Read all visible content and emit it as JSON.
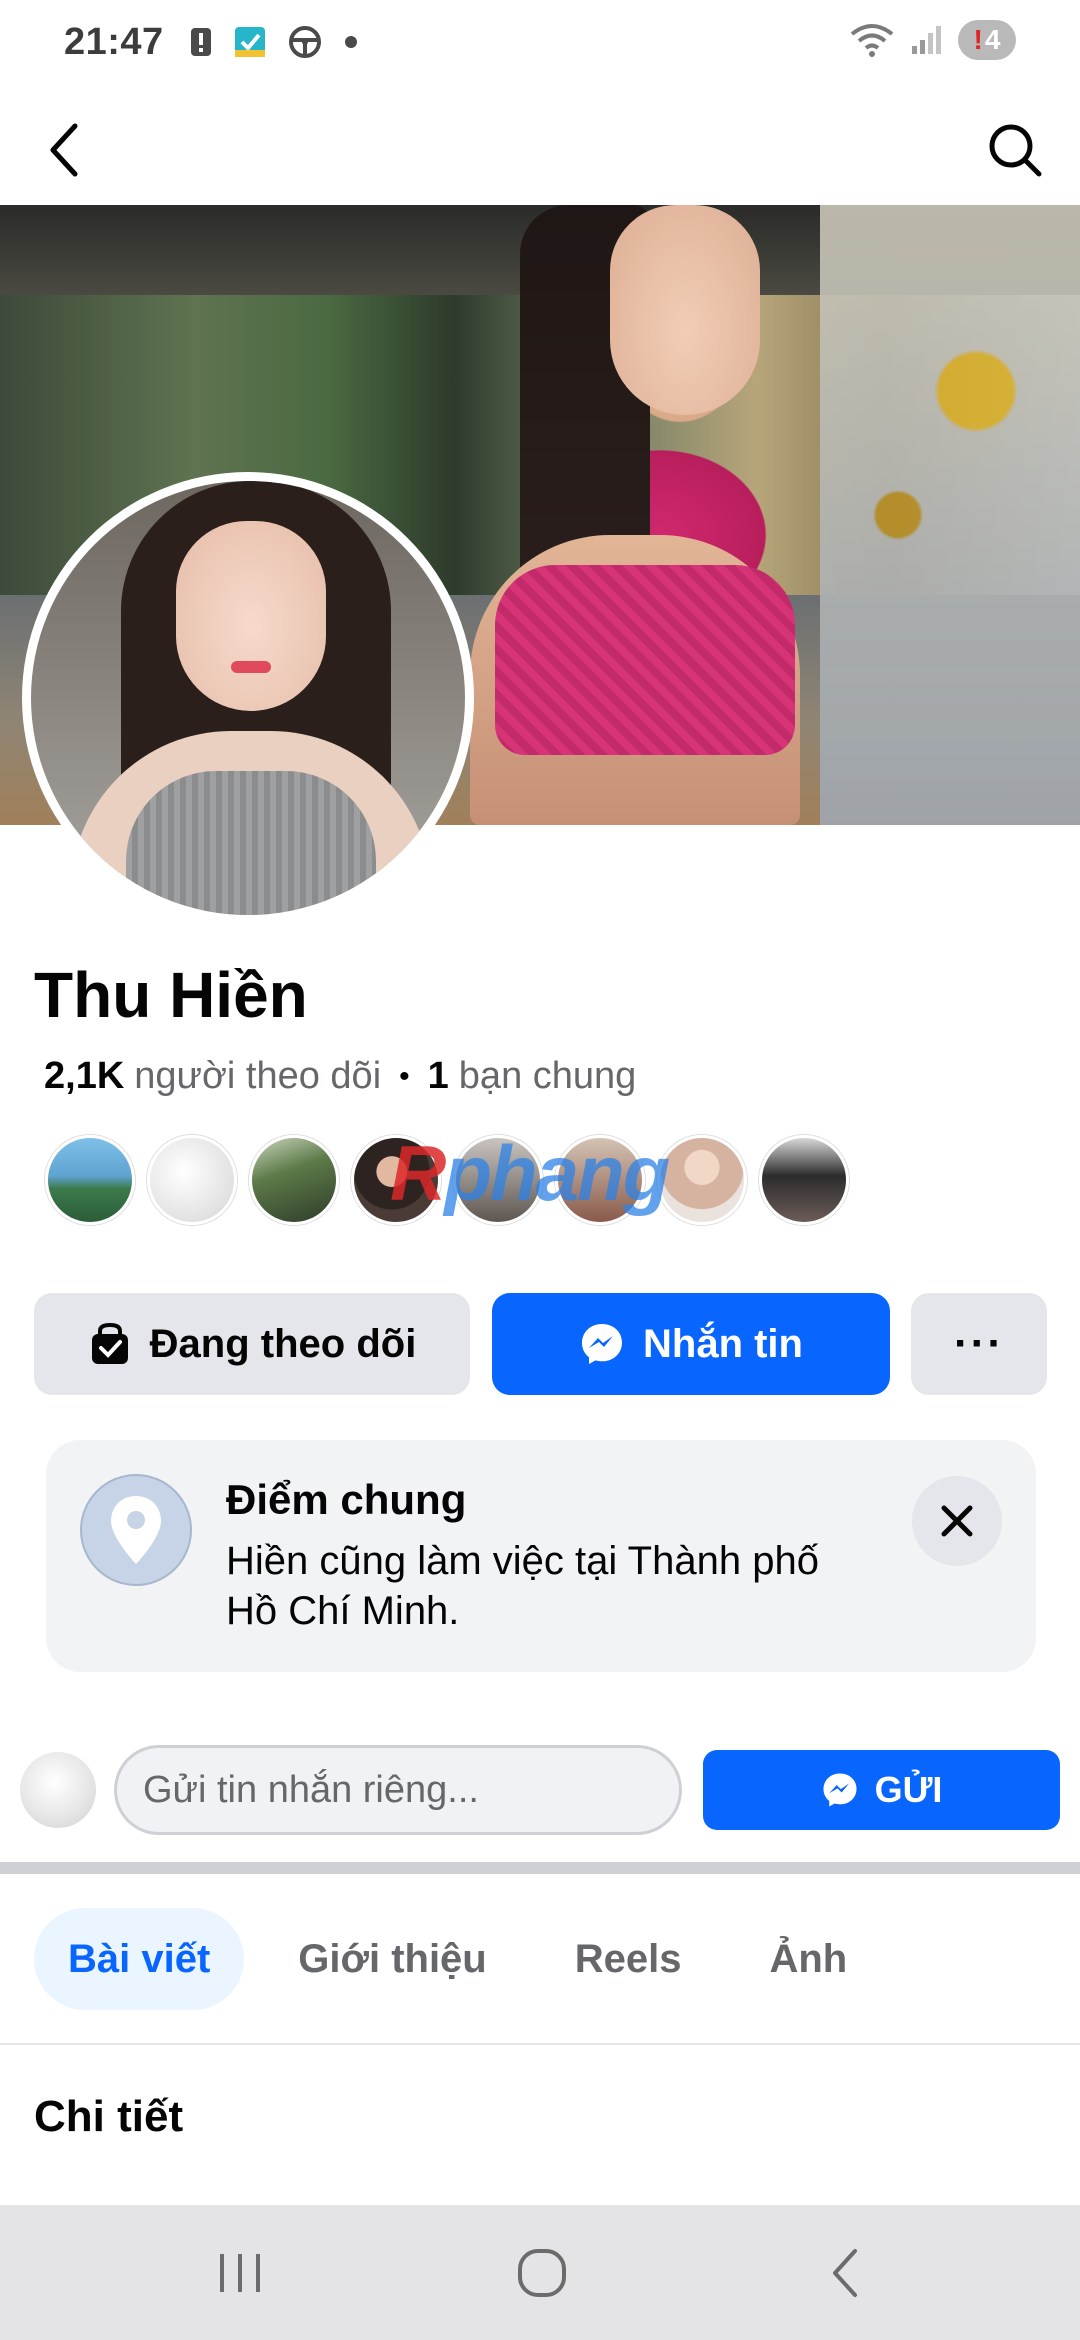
{
  "status_bar": {
    "time": "21:47",
    "battery_level": "4"
  },
  "profile": {
    "name": "Thu Hiền",
    "followers_count": "2,1K",
    "followers_label": "người theo dõi",
    "separator": "•",
    "mutual_count": "1",
    "mutual_label": "bạn chung"
  },
  "watermark": {
    "first_letter": "R",
    "rest": "phang"
  },
  "actions": {
    "following_label": "Đang theo dõi",
    "message_label": "Nhắn tin",
    "more_label": "···"
  },
  "common_point": {
    "title": "Điểm chung",
    "text": "Hiền cũng làm việc tại Thành phố Hồ Chí Minh."
  },
  "private_message": {
    "placeholder": "Gửi tin nhắn riêng...",
    "send_label": "GỬI"
  },
  "tabs": [
    {
      "label": "Bài viết",
      "active": true
    },
    {
      "label": "Giới thiệu",
      "active": false
    },
    {
      "label": "Reels",
      "active": false
    },
    {
      "label": "Ảnh",
      "active": false
    }
  ],
  "section": {
    "title": "Chi tiết"
  },
  "icons": {
    "back": "chevron-left-icon",
    "search": "search-icon",
    "following": "following-bag-icon",
    "messenger": "messenger-icon",
    "location": "location-pin-icon",
    "close": "close-icon"
  },
  "colors": {
    "accent": "#0866ff",
    "button_gray": "#e4e6eb",
    "card_bg": "#f2f3f5",
    "secondary_text": "#65676b",
    "tab_active_bg": "#ebf5ff"
  }
}
